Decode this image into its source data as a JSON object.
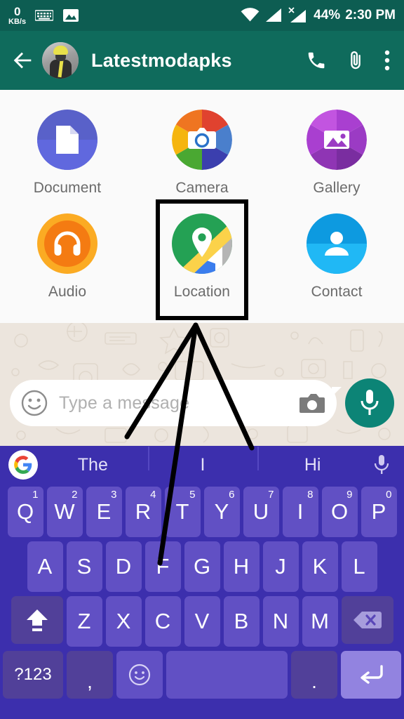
{
  "status_bar": {
    "network_speed_value": "0",
    "network_speed_unit": "KB/s",
    "icons": [
      "keyboard-icon",
      "image-icon",
      "wifi-icon",
      "signal-icon",
      "signal-no-service-icon"
    ],
    "battery_percent": "44%",
    "time": "2:30 PM"
  },
  "app_bar": {
    "back_label": "back-arrow",
    "contact_name": "Latestmodapks",
    "actions": [
      "call-icon",
      "attach-icon",
      "overflow-menu-icon"
    ]
  },
  "attachment_panel": {
    "items": [
      {
        "label": "Document",
        "icon": "document-icon",
        "color": "#5961c9",
        "highlighted": false
      },
      {
        "label": "Camera",
        "icon": "camera-icon",
        "color": "#e8502f",
        "highlighted": false
      },
      {
        "label": "Gallery",
        "icon": "gallery-icon",
        "color": "#b045c9",
        "highlighted": false
      },
      {
        "label": "Audio",
        "icon": "audio-icon",
        "color": "#fbab23",
        "highlighted": false
      },
      {
        "label": "Location",
        "icon": "location-icon",
        "color": "#24a154",
        "highlighted": true
      },
      {
        "label": "Contact",
        "icon": "contact-icon",
        "color": "#0d9ae0",
        "highlighted": false
      }
    ]
  },
  "message_input": {
    "placeholder": "Type a message",
    "value": "",
    "emoji_icon": "emoji-smiley-icon",
    "camera_icon": "camera-icon",
    "mic_icon": "microphone-icon",
    "mic_button_color": "#0c8476"
  },
  "keyboard": {
    "suggestions": [
      "The",
      "I",
      "Hi"
    ],
    "google_logo": "google-g-icon",
    "voice_icon": "microphone-icon",
    "row1": [
      {
        "letter": "Q",
        "num": "1"
      },
      {
        "letter": "W",
        "num": "2"
      },
      {
        "letter": "E",
        "num": "3"
      },
      {
        "letter": "R",
        "num": "4"
      },
      {
        "letter": "T",
        "num": "5"
      },
      {
        "letter": "Y",
        "num": "6"
      },
      {
        "letter": "U",
        "num": "7"
      },
      {
        "letter": "I",
        "num": "8"
      },
      {
        "letter": "O",
        "num": "9"
      },
      {
        "letter": "P",
        "num": "0"
      }
    ],
    "row2": [
      {
        "letter": "A"
      },
      {
        "letter": "S"
      },
      {
        "letter": "D"
      },
      {
        "letter": "F"
      },
      {
        "letter": "G"
      },
      {
        "letter": "H"
      },
      {
        "letter": "J"
      },
      {
        "letter": "K"
      },
      {
        "letter": "L"
      }
    ],
    "row3": [
      {
        "letter": "Z"
      },
      {
        "letter": "X"
      },
      {
        "letter": "C"
      },
      {
        "letter": "V"
      },
      {
        "letter": "B"
      },
      {
        "letter": "N"
      },
      {
        "letter": "M"
      }
    ],
    "shift_icon": "shift-icon",
    "backspace_icon": "backspace-icon",
    "symbols_label": "?123",
    "comma_label": ",",
    "emoji_icon": "emoji-smiley-icon",
    "space_label": "",
    "period_label": ".",
    "enter_icon": "enter-icon",
    "theme_color": "#3c2fad",
    "key_color": "#6150c4"
  },
  "annotation": {
    "type": "pointer-lines",
    "color": "#000000",
    "target": "Location"
  }
}
